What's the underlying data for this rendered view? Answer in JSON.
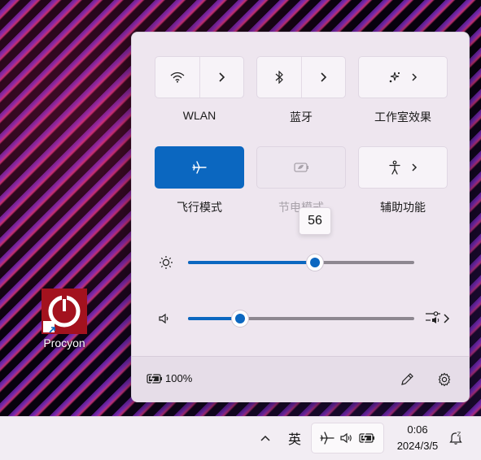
{
  "desktop": {
    "icons": [
      {
        "label": "Procyon",
        "icon": "procyon-app-icon"
      }
    ]
  },
  "quick_settings": {
    "tiles": [
      {
        "label": "WLAN",
        "icon": "wifi-icon",
        "state": "off"
      },
      {
        "label": "蓝牙",
        "icon": "bluetooth-icon",
        "state": "off"
      },
      {
        "label": "工作室效果",
        "icon": "studio-effects-icon",
        "state": "off"
      },
      {
        "label": "飞行模式",
        "icon": "airplane-icon",
        "state": "on"
      },
      {
        "label": "节电模式",
        "icon": "battery-saver-icon",
        "state": "disabled"
      },
      {
        "label": "辅助功能",
        "icon": "accessibility-icon",
        "state": "off"
      }
    ],
    "tooltip_value": "56",
    "brightness": {
      "value": 56,
      "icon": "brightness-icon"
    },
    "volume": {
      "value": 23,
      "icon": "speaker-icon"
    },
    "battery_percent": "100%",
    "accent_color": "#0b67c0"
  },
  "taskbar": {
    "ime": "英",
    "clock_time": "0:06",
    "clock_date": "2024/3/5"
  }
}
